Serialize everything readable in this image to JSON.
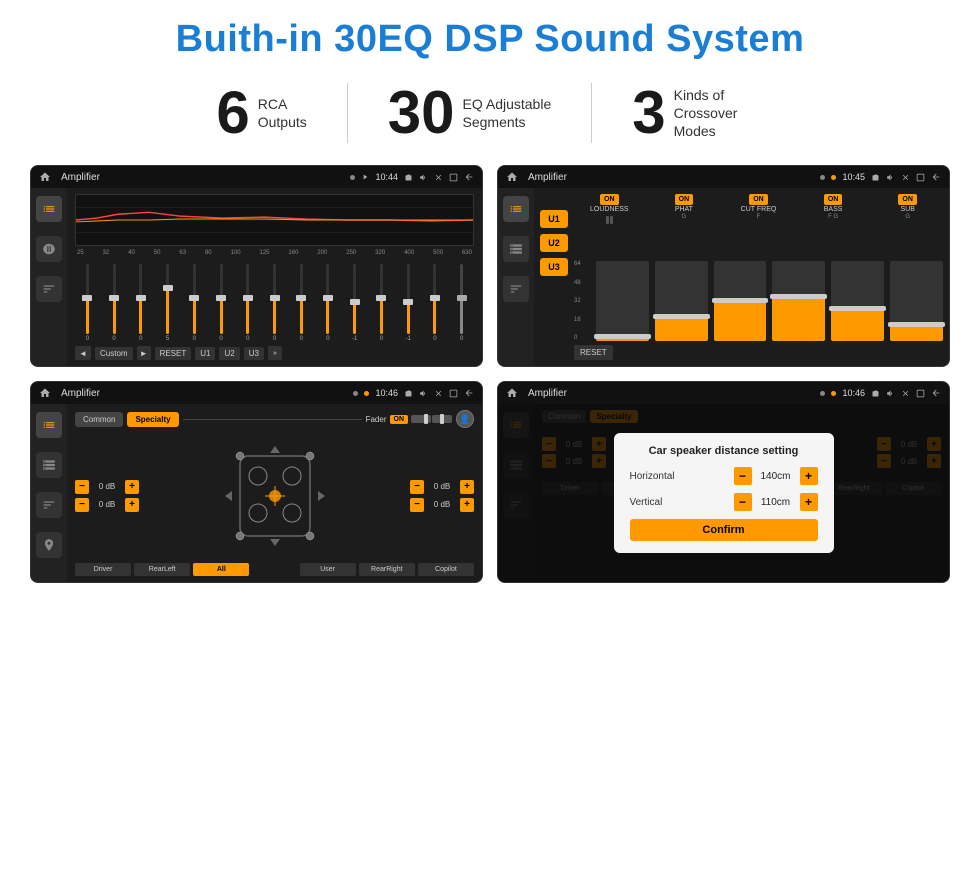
{
  "page": {
    "title": "Buith-in 30EQ DSP Sound System",
    "stats": [
      {
        "number": "6",
        "label": "RCA\nOutputs"
      },
      {
        "number": "30",
        "label": "EQ Adjustable\nSegments"
      },
      {
        "number": "3",
        "label": "Kinds of\nCrossover Modes"
      }
    ],
    "screens": [
      {
        "id": "eq-screen",
        "title": "Amplifier",
        "time": "10:44",
        "type": "equalizer"
      },
      {
        "id": "crossover-screen",
        "title": "Amplifier",
        "time": "10:45",
        "type": "crossover"
      },
      {
        "id": "fader-screen",
        "title": "Amplifier",
        "time": "10:46",
        "type": "fader"
      },
      {
        "id": "distance-screen",
        "title": "Amplifier",
        "time": "10:46",
        "type": "distance"
      }
    ],
    "eq": {
      "freqs": [
        "25",
        "32",
        "40",
        "50",
        "63",
        "80",
        "100",
        "125",
        "160",
        "200",
        "250",
        "320",
        "400",
        "500",
        "630"
      ],
      "values": [
        "0",
        "0",
        "0",
        "5",
        "0",
        "0",
        "0",
        "0",
        "0",
        "0",
        "-1",
        "0",
        "-1",
        "",
        ""
      ],
      "preset": "Custom",
      "buttons": [
        "RESET",
        "U1",
        "U2",
        "U3"
      ]
    },
    "crossover": {
      "presets": [
        "U1",
        "U2",
        "U3"
      ],
      "channels": [
        "LOUDNESS",
        "PHAT",
        "CUT FREQ",
        "BASS",
        "SUB"
      ],
      "resetLabel": "RESET"
    },
    "fader": {
      "tabs": [
        "Common",
        "Specialty"
      ],
      "activeTab": "Specialty",
      "faderLabel": "Fader",
      "onLabel": "ON",
      "volumes": [
        "0 dB",
        "0 dB",
        "0 dB",
        "0 dB"
      ],
      "buttons": [
        "Driver",
        "RearLeft",
        "All",
        "RearRight",
        "Copilot",
        "User"
      ]
    },
    "dialog": {
      "title": "Car speaker distance setting",
      "horizontal": {
        "label": "Horizontal",
        "value": "140cm"
      },
      "vertical": {
        "label": "Vertical",
        "value": "110cm"
      },
      "confirmLabel": "Confirm"
    }
  }
}
